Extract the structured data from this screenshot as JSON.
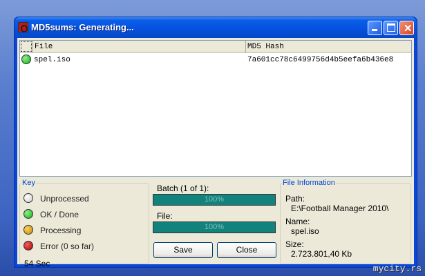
{
  "window": {
    "title": "MD5sums: Generating..."
  },
  "list": {
    "columns": [
      "File",
      "MD5 Hash"
    ],
    "rows": [
      {
        "status": "ok",
        "file": "spel.iso",
        "hash": "7a601cc78c6499756d4b5eefa6b436e8"
      }
    ]
  },
  "key": {
    "title": "Key",
    "items": [
      {
        "label": "Unprocessed",
        "color": "#e0e0e0"
      },
      {
        "label": "OK / Done",
        "color": "#20c020"
      },
      {
        "label": "Processing",
        "color": "#e0a010"
      },
      {
        "label": "Error (0 so far)",
        "color": "#d01010"
      }
    ],
    "elapsed": "54 Sec"
  },
  "progress": {
    "batch_label": "Batch (1 of 1):",
    "batch_percent": 100,
    "batch_text": "100%",
    "file_label": "File:",
    "file_percent": 100,
    "file_text": "100%"
  },
  "buttons": {
    "save": "Save",
    "close": "Close"
  },
  "info": {
    "title": "File Information",
    "path_label": "Path:",
    "path": "E:\\Football Manager 2010\\",
    "name_label": "Name:",
    "name": "spel.iso",
    "size_label": "Size:",
    "size": "2.723.801,40 Kb"
  },
  "watermark": "mycity.rs"
}
